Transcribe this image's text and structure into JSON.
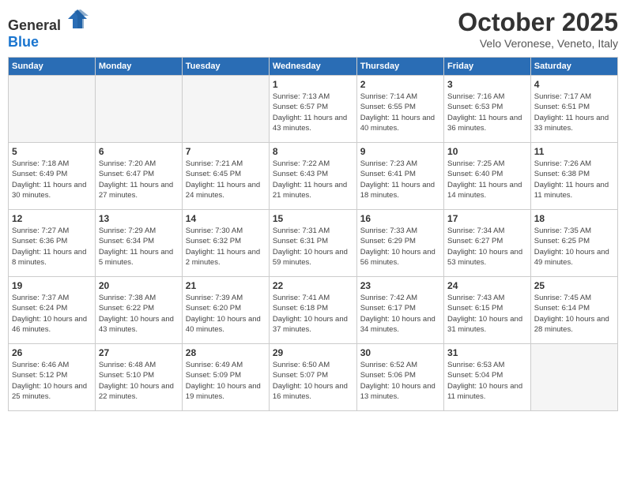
{
  "header": {
    "logo_general": "General",
    "logo_blue": "Blue",
    "month_title": "October 2025",
    "subtitle": "Velo Veronese, Veneto, Italy"
  },
  "days_of_week": [
    "Sunday",
    "Monday",
    "Tuesday",
    "Wednesday",
    "Thursday",
    "Friday",
    "Saturday"
  ],
  "weeks": [
    [
      {
        "day": "",
        "empty": true
      },
      {
        "day": "",
        "empty": true
      },
      {
        "day": "",
        "empty": true
      },
      {
        "day": "1",
        "sunrise": "7:13 AM",
        "sunset": "6:57 PM",
        "daylight": "11 hours and 43 minutes."
      },
      {
        "day": "2",
        "sunrise": "7:14 AM",
        "sunset": "6:55 PM",
        "daylight": "11 hours and 40 minutes."
      },
      {
        "day": "3",
        "sunrise": "7:16 AM",
        "sunset": "6:53 PM",
        "daylight": "11 hours and 36 minutes."
      },
      {
        "day": "4",
        "sunrise": "7:17 AM",
        "sunset": "6:51 PM",
        "daylight": "11 hours and 33 minutes."
      }
    ],
    [
      {
        "day": "5",
        "sunrise": "7:18 AM",
        "sunset": "6:49 PM",
        "daylight": "11 hours and 30 minutes."
      },
      {
        "day": "6",
        "sunrise": "7:20 AM",
        "sunset": "6:47 PM",
        "daylight": "11 hours and 27 minutes."
      },
      {
        "day": "7",
        "sunrise": "7:21 AM",
        "sunset": "6:45 PM",
        "daylight": "11 hours and 24 minutes."
      },
      {
        "day": "8",
        "sunrise": "7:22 AM",
        "sunset": "6:43 PM",
        "daylight": "11 hours and 21 minutes."
      },
      {
        "day": "9",
        "sunrise": "7:23 AM",
        "sunset": "6:41 PM",
        "daylight": "11 hours and 18 minutes."
      },
      {
        "day": "10",
        "sunrise": "7:25 AM",
        "sunset": "6:40 PM",
        "daylight": "11 hours and 14 minutes."
      },
      {
        "day": "11",
        "sunrise": "7:26 AM",
        "sunset": "6:38 PM",
        "daylight": "11 hours and 11 minutes."
      }
    ],
    [
      {
        "day": "12",
        "sunrise": "7:27 AM",
        "sunset": "6:36 PM",
        "daylight": "11 hours and 8 minutes."
      },
      {
        "day": "13",
        "sunrise": "7:29 AM",
        "sunset": "6:34 PM",
        "daylight": "11 hours and 5 minutes."
      },
      {
        "day": "14",
        "sunrise": "7:30 AM",
        "sunset": "6:32 PM",
        "daylight": "11 hours and 2 minutes."
      },
      {
        "day": "15",
        "sunrise": "7:31 AM",
        "sunset": "6:31 PM",
        "daylight": "10 hours and 59 minutes."
      },
      {
        "day": "16",
        "sunrise": "7:33 AM",
        "sunset": "6:29 PM",
        "daylight": "10 hours and 56 minutes."
      },
      {
        "day": "17",
        "sunrise": "7:34 AM",
        "sunset": "6:27 PM",
        "daylight": "10 hours and 53 minutes."
      },
      {
        "day": "18",
        "sunrise": "7:35 AM",
        "sunset": "6:25 PM",
        "daylight": "10 hours and 49 minutes."
      }
    ],
    [
      {
        "day": "19",
        "sunrise": "7:37 AM",
        "sunset": "6:24 PM",
        "daylight": "10 hours and 46 minutes."
      },
      {
        "day": "20",
        "sunrise": "7:38 AM",
        "sunset": "6:22 PM",
        "daylight": "10 hours and 43 minutes."
      },
      {
        "day": "21",
        "sunrise": "7:39 AM",
        "sunset": "6:20 PM",
        "daylight": "10 hours and 40 minutes."
      },
      {
        "day": "22",
        "sunrise": "7:41 AM",
        "sunset": "6:18 PM",
        "daylight": "10 hours and 37 minutes."
      },
      {
        "day": "23",
        "sunrise": "7:42 AM",
        "sunset": "6:17 PM",
        "daylight": "10 hours and 34 minutes."
      },
      {
        "day": "24",
        "sunrise": "7:43 AM",
        "sunset": "6:15 PM",
        "daylight": "10 hours and 31 minutes."
      },
      {
        "day": "25",
        "sunrise": "7:45 AM",
        "sunset": "6:14 PM",
        "daylight": "10 hours and 28 minutes."
      }
    ],
    [
      {
        "day": "26",
        "sunrise": "6:46 AM",
        "sunset": "5:12 PM",
        "daylight": "10 hours and 25 minutes."
      },
      {
        "day": "27",
        "sunrise": "6:48 AM",
        "sunset": "5:10 PM",
        "daylight": "10 hours and 22 minutes."
      },
      {
        "day": "28",
        "sunrise": "6:49 AM",
        "sunset": "5:09 PM",
        "daylight": "10 hours and 19 minutes."
      },
      {
        "day": "29",
        "sunrise": "6:50 AM",
        "sunset": "5:07 PM",
        "daylight": "10 hours and 16 minutes."
      },
      {
        "day": "30",
        "sunrise": "6:52 AM",
        "sunset": "5:06 PM",
        "daylight": "10 hours and 13 minutes."
      },
      {
        "day": "31",
        "sunrise": "6:53 AM",
        "sunset": "5:04 PM",
        "daylight": "10 hours and 11 minutes."
      },
      {
        "day": "",
        "empty": true
      }
    ]
  ]
}
